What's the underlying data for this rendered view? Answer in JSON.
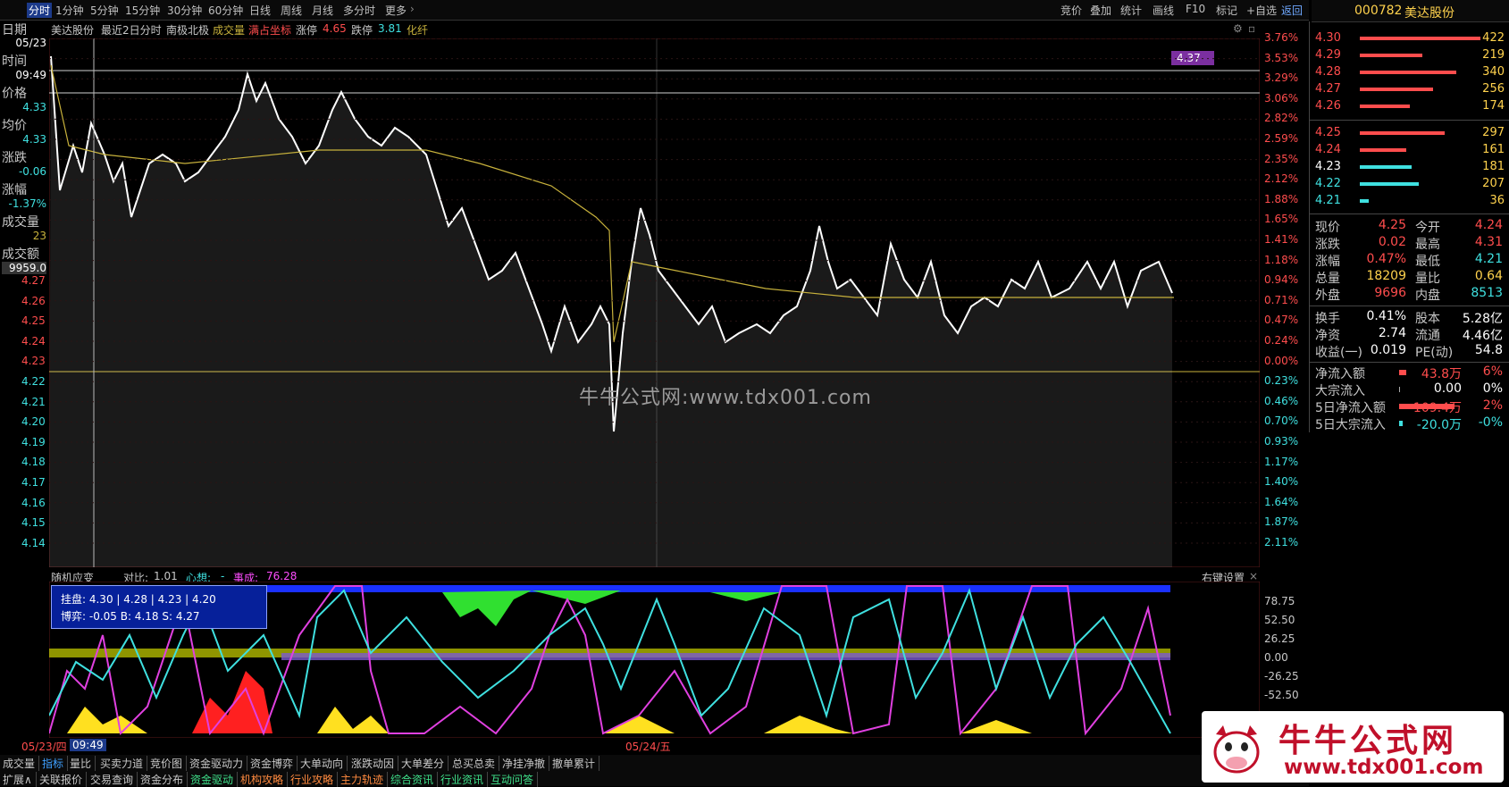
{
  "toolbar": {
    "periods": [
      "分时",
      "1分钟",
      "5分钟",
      "15分钟",
      "30分钟",
      "60分钟",
      "日线",
      "周线",
      "月线",
      "多分时",
      "更多"
    ],
    "right_tools": [
      "竞价",
      "叠加",
      "统计",
      "画线",
      "F10",
      "标记",
      "+自选",
      "返回"
    ]
  },
  "stock": {
    "code": "000782",
    "name": "美达股份",
    "right_axis_label": "4.37"
  },
  "infobar": {
    "name": "美达股份",
    "mode": "最近2日分时",
    "indicator": "南极北极",
    "volume": "成交量",
    "full_coord": "满占坐标",
    "limit_up_label": "涨停",
    "limit_up": "4.65",
    "limit_down_label": "跌停",
    "limit_down": "3.81",
    "fiber": "化纤"
  },
  "left_panel": [
    {
      "label": "日期",
      "value": "05/23"
    },
    {
      "label": "时间",
      "value": "09:49"
    },
    {
      "label": "价格",
      "value": "4.33"
    },
    {
      "label": "均价",
      "value": "4.33"
    },
    {
      "label": "涨跌",
      "value": "-0.06"
    },
    {
      "label": "涨幅",
      "value": "-1.37%"
    },
    {
      "label": "成交量",
      "value": "23"
    },
    {
      "label": "成交额",
      "value": "9959.0"
    }
  ],
  "price_axis": [
    "4.27",
    "4.26",
    "4.25",
    "4.24",
    "4.23",
    "4.22",
    "4.21",
    "4.20",
    "4.19",
    "4.18",
    "4.17",
    "4.16",
    "4.15",
    "4.14"
  ],
  "pct_axis": [
    "3.76%",
    "3.53%",
    "3.29%",
    "3.06%",
    "2.82%",
    "2.59%",
    "2.35%",
    "2.12%",
    "1.88%",
    "1.65%",
    "1.41%",
    "1.18%",
    "0.94%",
    "0.71%",
    "0.47%",
    "0.24%",
    "0.00%",
    "0.23%",
    "0.46%",
    "0.70%",
    "0.93%",
    "1.17%",
    "1.40%",
    "1.64%",
    "1.87%",
    "2.11%"
  ],
  "indicator": {
    "title": "随机应变",
    "ratio_label": "对比:",
    "ratio": "1.01",
    "mind_label": "心想:",
    "mind": "-",
    "done_label": "事成:",
    "done": "76.28",
    "settings": "右键设置",
    "axis": [
      "78.75",
      "52.50",
      "26.25",
      "0.00",
      "-26.25",
      "-52.50"
    ]
  },
  "popup": {
    "line1": "挂盘: 4.30 | 4.28 | 4.23 | 4.20",
    "line2": "博弈: -0.05  B: 4.18  S: 4.27"
  },
  "timebar": {
    "d1": "05/23/四",
    "t1": "09:49",
    "d2": "05/24/五"
  },
  "tabs_row1": [
    "成交量",
    "指标",
    "量比",
    "买卖力道",
    "竞价图",
    "资金驱动力",
    "资金博弈",
    "大单动向",
    "涨跌动因",
    "大单差分",
    "总买总卖",
    "净挂净撤",
    "撤单累计"
  ],
  "tabs_row2": [
    "扩展∧",
    "关联报价",
    "交易查询",
    "资金分布",
    "资金驱动",
    "机构攻略",
    "行业攻略",
    "主力轨迹",
    "综合资讯",
    "行业资讯",
    "互动问答"
  ],
  "orderbook": {
    "sell": [
      {
        "price": "4.30",
        "vol": "422"
      },
      {
        "price": "4.29",
        "vol": "219"
      },
      {
        "price": "4.28",
        "vol": "340"
      },
      {
        "price": "4.27",
        "vol": "256"
      },
      {
        "price": "4.26",
        "vol": "174"
      }
    ],
    "buy": [
      {
        "price": "4.25",
        "vol": "297"
      },
      {
        "price": "4.24",
        "vol": "161"
      },
      {
        "price": "4.23",
        "vol": "181"
      },
      {
        "price": "4.22",
        "vol": "207"
      },
      {
        "price": "4.21",
        "vol": "36"
      }
    ]
  },
  "stats": [
    {
      "l1": "现价",
      "v1": "4.25",
      "l2": "今开",
      "v2": "4.24"
    },
    {
      "l1": "涨跌",
      "v1": "0.02",
      "l2": "最高",
      "v2": "4.31"
    },
    {
      "l1": "涨幅",
      "v1": "0.47%",
      "l2": "最低",
      "v2": "4.21"
    },
    {
      "l1": "总量",
      "v1": "18209",
      "l2": "量比",
      "v2": "0.64"
    },
    {
      "l1": "外盘",
      "v1": "9696",
      "l2": "内盘",
      "v2": "8513"
    }
  ],
  "stats2": [
    {
      "l1": "换手",
      "v1": "0.41%",
      "l2": "股本",
      "v2": "5.28亿"
    },
    {
      "l1": "净资",
      "v1": "2.74",
      "l2": "流通",
      "v2": "4.46亿"
    },
    {
      "l1": "收益(一)",
      "v1": "0.019",
      "l2": "PE(动)",
      "v2": "54.8"
    }
  ],
  "flows": [
    {
      "label": "净流入额",
      "value": "43.8万",
      "pct": "6%"
    },
    {
      "label": "大宗流入",
      "value": "0.00",
      "pct": "0%"
    },
    {
      "label": "5日净流入额",
      "value": "109.4万",
      "pct": "2%"
    },
    {
      "label": "5日大宗流入",
      "value": "-20.0万",
      "pct": "-0%"
    }
  ],
  "watermark": "牛牛公式网:www.tdx001.com",
  "logo": {
    "title": "牛牛公式网",
    "url": "www.tdx001.com"
  },
  "colors": {
    "up": "#ff4d4d",
    "down": "#3fe0e0",
    "avg": "#c8b23c",
    "price": "#ffffff",
    "accent": "#ffd24d"
  }
}
